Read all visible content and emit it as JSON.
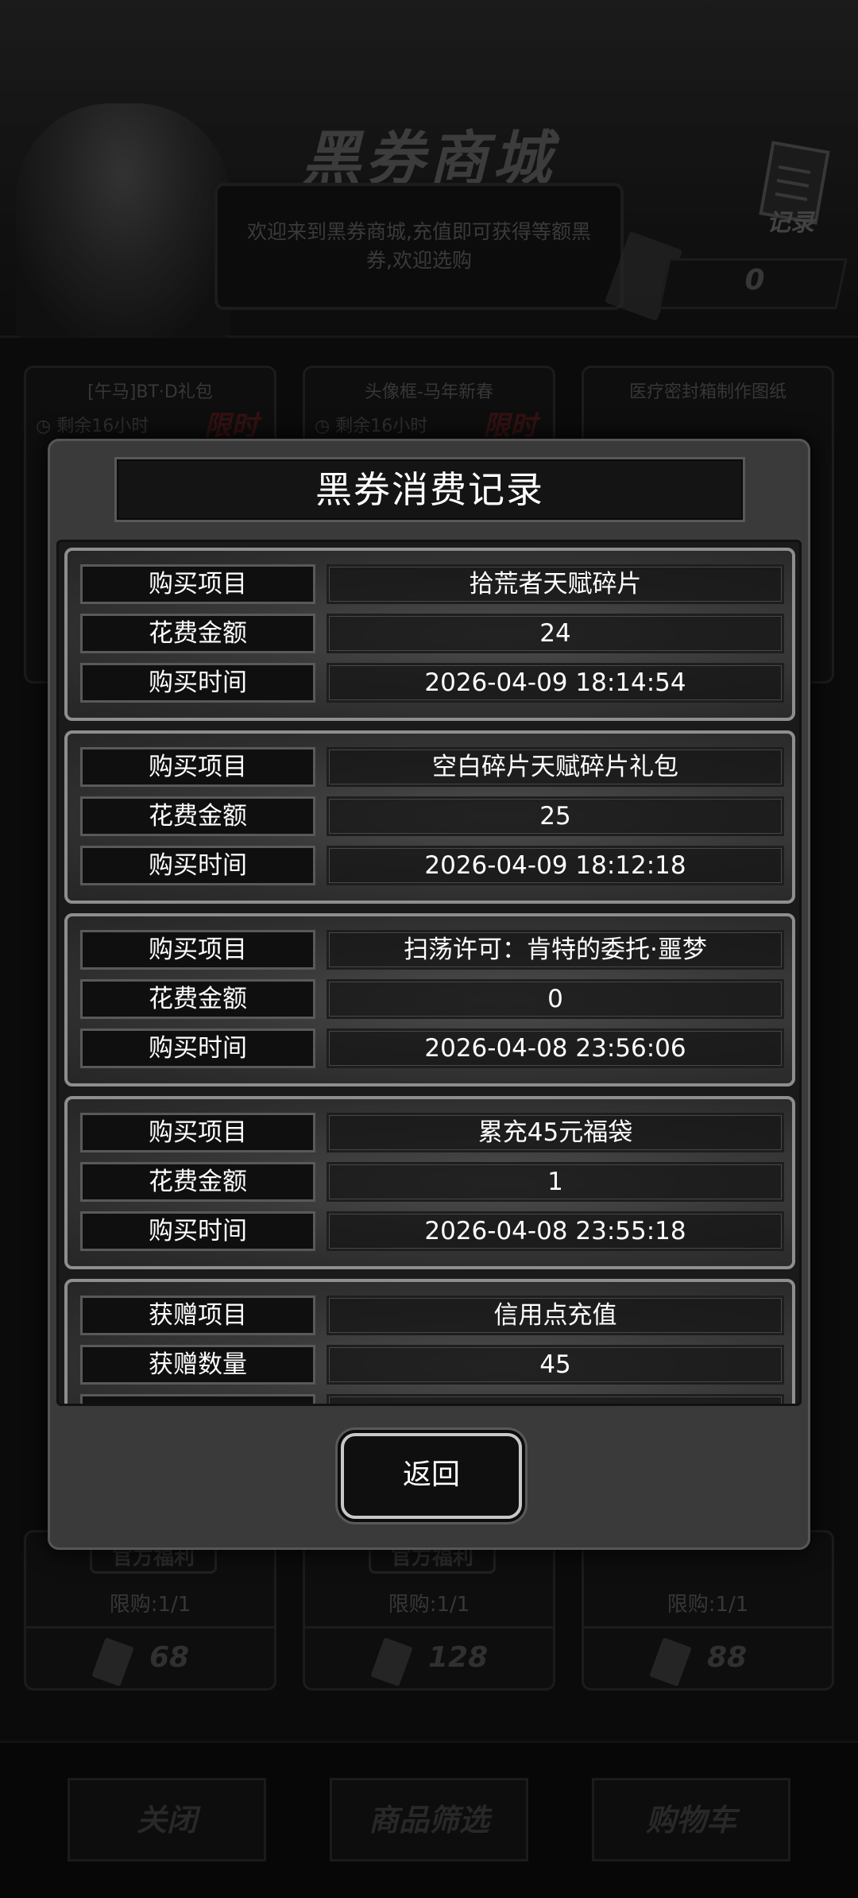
{
  "shop": {
    "title": "黑券商城",
    "welcome": "欢迎来到黑券商城,充值即可获得等额黑券,欢迎选购",
    "records_label": "记录",
    "balance": "0"
  },
  "cards_row1": [
    {
      "title": "[午马]BT·D礼包",
      "timer": "剩余16小时",
      "limited": "限时"
    },
    {
      "title": "头像框-马年新春",
      "timer": "剩余16小时",
      "limited": "限时"
    },
    {
      "title": "医疗密封箱制作图纸"
    }
  ],
  "cards_row2": [
    {
      "badge": "官方福利",
      "limit": "限购:1/1",
      "price": "68"
    },
    {
      "badge": "官方福利",
      "limit": "限购:1/1",
      "price": "128"
    },
    {
      "limit": "限购:1/1",
      "price": "88"
    }
  ],
  "bottom_bar": {
    "close": "关闭",
    "filter": "商品筛选",
    "cart": "购物车"
  },
  "modal": {
    "title": "黑券消费记录",
    "back": "返回",
    "records": [
      {
        "rows": [
          {
            "label": "购买项目",
            "value": "拾荒者天赋碎片"
          },
          {
            "label": "花费金额",
            "value": "24"
          },
          {
            "label": "购买时间",
            "value": "2026-04-09 18:14:54"
          }
        ]
      },
      {
        "rows": [
          {
            "label": "购买项目",
            "value": "空白碎片天赋碎片礼包"
          },
          {
            "label": "花费金额",
            "value": "25"
          },
          {
            "label": "购买时间",
            "value": "2026-04-09 18:12:18"
          }
        ]
      },
      {
        "rows": [
          {
            "label": "购买项目",
            "value": "扫荡许可：肯特的委托·噩梦"
          },
          {
            "label": "花费金额",
            "value": "0"
          },
          {
            "label": "购买时间",
            "value": "2026-04-08 23:56:06"
          }
        ]
      },
      {
        "rows": [
          {
            "label": "购买项目",
            "value": "累充45元福袋"
          },
          {
            "label": "花费金额",
            "value": "1"
          },
          {
            "label": "购买时间",
            "value": "2026-04-08 23:55:18"
          }
        ]
      },
      {
        "rows": [
          {
            "label": "获赠项目",
            "value": "信用点充值"
          },
          {
            "label": "获赠数量",
            "value": "45"
          }
        ]
      }
    ]
  }
}
